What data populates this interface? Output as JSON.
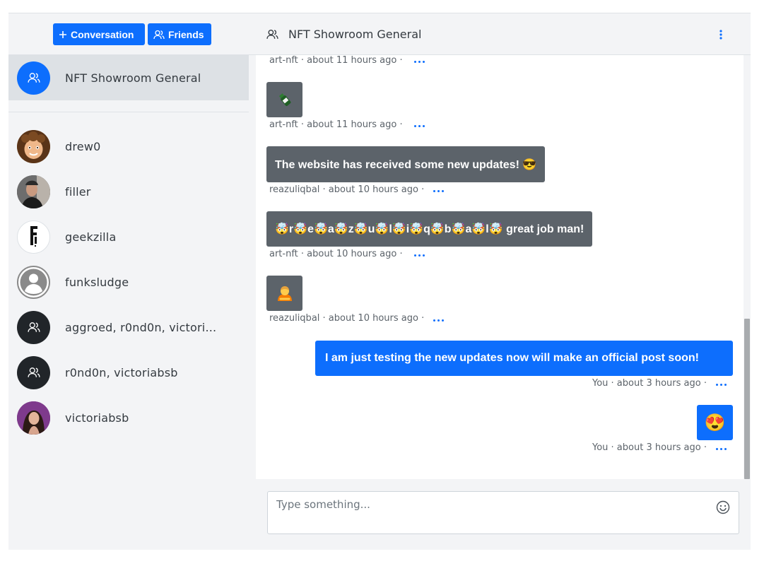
{
  "sidebar": {
    "conversation_button": "Conversation",
    "friends_button": "Friends",
    "items": [
      {
        "label": "NFT Showroom General",
        "avatar": "group-icon",
        "active": true
      },
      {
        "label": "drew0",
        "avatar": "memoji-avatar"
      },
      {
        "label": "filler",
        "avatar": "photo-avatar"
      },
      {
        "label": "geekzilla",
        "avatar": "logo-avatar"
      },
      {
        "label": "funksludge",
        "avatar": "default-user-icon"
      },
      {
        "label": "aggroed, r0nd0n, victori...",
        "avatar": "group-icon"
      },
      {
        "label": "r0nd0n, victoriabsb",
        "avatar": "group-icon"
      },
      {
        "label": "victoriabsb",
        "avatar": "photo-avatar"
      }
    ]
  },
  "header": {
    "room_title": "NFT Showroom General"
  },
  "messages": [
    {
      "meta": "art-nft · about 11 hours ago  ·"
    },
    {
      "content_icon": "bottle-emoji",
      "meta": "art-nft · about 11 hours ago  ·"
    },
    {
      "text": "The website has received some new updates! 😎",
      "meta": "reazuliqbal · about 10 hours ago  ·"
    },
    {
      "text": "🤯r🤯e🤯a🤯z🤯u🤯l🤯i🤯q🤯b🤯a🤯l🤯 great job man!",
      "meta": "art-nft · about 10 hours ago  ·"
    },
    {
      "content_icon": "person-bowing-emoji",
      "meta": "reazuliqbal · about 10 hours ago  ·"
    },
    {
      "text": "I am just testing the new updates now will make an official post soon!",
      "meta": "You · about 3 hours ago  ·",
      "mine": true
    },
    {
      "text": "😍",
      "meta": "You · about 3 hours ago  ·",
      "mine": true
    }
  ],
  "composer": {
    "placeholder": "Type something..."
  },
  "colors": {
    "accent": "#0d6efd",
    "bubble_other": "#5c636a",
    "sidebar_bg": "#f3f4f6",
    "active_item_bg": "#dde1e5"
  }
}
